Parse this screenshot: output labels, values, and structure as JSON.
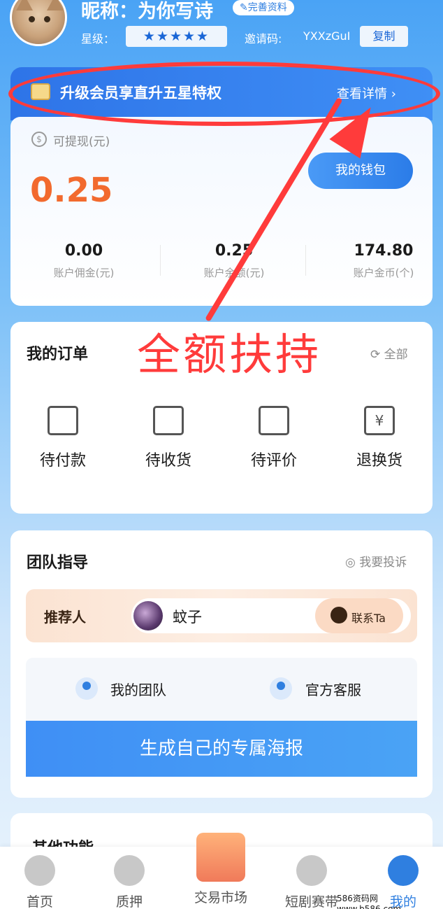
{
  "header": {
    "nickname": "昵称：为你写诗",
    "complete_label": "完善资料",
    "star_label": "星级：",
    "stars": "★★★★★",
    "invite_label": "邀请码:",
    "invite_code": "YXXzGuI",
    "copy_label": "复制"
  },
  "vip": {
    "text": "升级会员享直升五星特权",
    "more": "查看详情 ›"
  },
  "wallet": {
    "label": "可提现(元)",
    "amount": "0.25",
    "button": "我的钱包",
    "stats": [
      {
        "value": "0.00",
        "label": "账户佣金(元)"
      },
      {
        "value": "0.25",
        "label": "账户余额(元)"
      },
      {
        "value": "174.80",
        "label": "账户金币(个)"
      }
    ]
  },
  "annotation": {
    "text": "全额扶持"
  },
  "orders": {
    "title": "我的订单",
    "all": "全部",
    "items": [
      "待付款",
      "待收货",
      "待评价",
      "退换货"
    ]
  },
  "team": {
    "title": "团队指导",
    "complaint": "我要投诉",
    "referrer_label": "推荐人",
    "referrer_name": "蚊子",
    "contact": "联系Ta",
    "my_team": "我的团队",
    "service": "官方客服",
    "poster": "生成自己的专属海报"
  },
  "other": {
    "title": "其他功能"
  },
  "tabbar": {
    "items": [
      "首页",
      "质押",
      "交易市场",
      "短剧赛带",
      "我的"
    ]
  },
  "watermark": "586资码网 www.b586.com",
  "colors": {
    "accent": "#2f7fe0",
    "amount": "#f26a2e",
    "annotation": "#ff3b3b"
  }
}
